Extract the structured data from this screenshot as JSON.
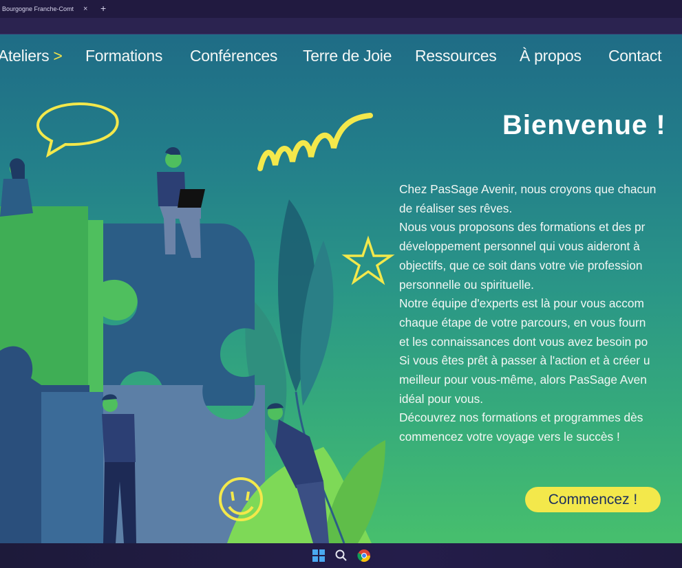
{
  "browser": {
    "tab_title": "Bourgogne Franche-Comt",
    "tab_close": "×",
    "new_tab": "+"
  },
  "nav": {
    "items": [
      {
        "label": "Ateliers",
        "chevron": ">"
      },
      {
        "label": "Formations"
      },
      {
        "label": "Conférences"
      },
      {
        "label": "Terre de Joie"
      },
      {
        "label": "Ressources"
      },
      {
        "label": "À propos"
      },
      {
        "label": "Contact"
      }
    ]
  },
  "hero": {
    "title": "Bienvenue !",
    "lines": [
      "Chez PasSage Avenir, nous croyons que chacun",
      "de réaliser ses rêves.",
      "Nous vous proposons des formations et des pr",
      "développement personnel qui vous aideront à",
      "objectifs, que ce soit dans votre vie profession",
      "personnelle ou spirituelle.",
      "Notre équipe d'experts est là pour vous accom",
      "chaque étape de votre parcours, en vous fourn",
      "et les connaissances dont vous avez besoin po",
      "Si vous êtes prêt à passer à l'action et à créer u",
      "meilleur pour vous-même, alors PasSage Aven",
      "idéal pour vous.",
      "Découvrez nos formations et programmes dès",
      "commencez votre voyage vers le succès !"
    ],
    "cta_label": "Commencez !"
  },
  "taskbar": {
    "icons": [
      "windows-start-icon",
      "search-icon",
      "chrome-icon"
    ]
  },
  "colors": {
    "accent_yellow": "#f3e84b",
    "nav_text": "#f4f7f6",
    "puzzle_dark": "#2b5d86",
    "puzzle_green": "#4fbf5e"
  }
}
